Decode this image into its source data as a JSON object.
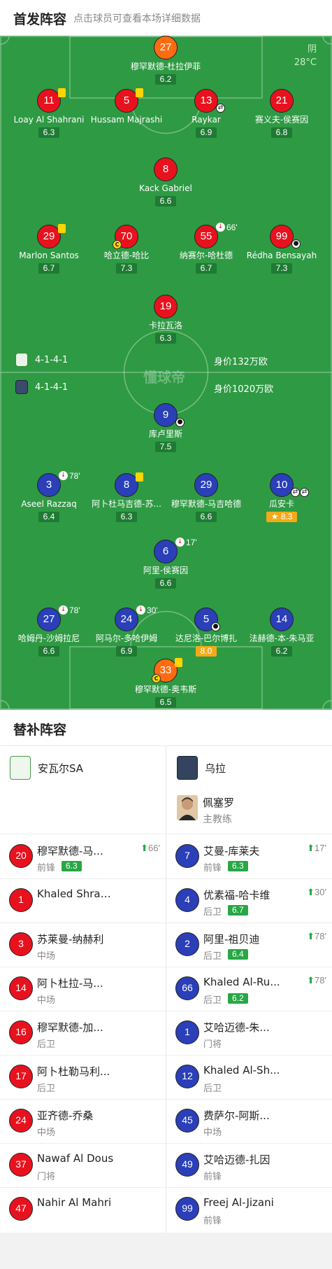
{
  "header": {
    "title": "首发阵容",
    "subtitle": "点击球员可查看本场详细数据"
  },
  "weather": {
    "condition": "阴",
    "temp": "28°C"
  },
  "watermark": "懂球帝",
  "home": {
    "team": "安瓦尔SA",
    "formation": "4-1-4-1",
    "value": "身价132万欧",
    "players": [
      {
        "num": "27",
        "name": "穆罕默德-杜拉伊菲",
        "rating": "6.2",
        "color": "orange"
      },
      {
        "num": "11",
        "name": "Loay Al Shahrani",
        "rating": "6.3",
        "color": "red"
      },
      {
        "num": "5",
        "name": "Hussam Majrashi",
        "rating": "",
        "color": "red"
      },
      {
        "num": "13",
        "name": "Raykar",
        "rating": "6.9",
        "color": "red"
      },
      {
        "num": "21",
        "name": "赛义夫-侯赛因",
        "rating": "6.8",
        "color": "red"
      },
      {
        "num": "8",
        "name": "Kack Gabriel",
        "rating": "6.6",
        "color": "red"
      },
      {
        "num": "29",
        "name": "Marlon Santos",
        "rating": "6.7",
        "color": "red"
      },
      {
        "num": "70",
        "name": "哈立德-哈比",
        "rating": "7.3",
        "color": "red"
      },
      {
        "num": "55",
        "name": "纳赛尔-哈杜德",
        "rating": "6.7",
        "color": "red",
        "sub": "66'"
      },
      {
        "num": "99",
        "name": "Rédha Bensayah",
        "rating": "7.3",
        "color": "red"
      },
      {
        "num": "19",
        "name": "卡拉瓦洛",
        "rating": "6.3",
        "color": "red"
      }
    ]
  },
  "away": {
    "team": "乌拉",
    "formation": "4-1-4-1",
    "value": "身价1020万欧",
    "coach": {
      "name": "佩塞罗",
      "role": "主教练"
    },
    "players": [
      {
        "num": "9",
        "name": "库卢里斯",
        "rating": "7.5",
        "color": "blue"
      },
      {
        "num": "3",
        "name": "Aseel Razzaq",
        "rating": "6.4",
        "color": "blue",
        "sub": "78'"
      },
      {
        "num": "8",
        "name": "阿卜杜马吉德-苏...",
        "rating": "6.3",
        "color": "blue"
      },
      {
        "num": "29",
        "name": "穆罕默德-马吉哈德",
        "rating": "6.6",
        "color": "blue"
      },
      {
        "num": "10",
        "name": "瓜安卡",
        "rating": "8.3",
        "color": "blue"
      },
      {
        "num": "6",
        "name": "阿里-侯赛因",
        "rating": "6.6",
        "color": "blue",
        "sub": "17'"
      },
      {
        "num": "27",
        "name": "哈姆丹-沙姆拉尼",
        "rating": "6.6",
        "color": "blue",
        "sub": "78'"
      },
      {
        "num": "24",
        "name": "阿马尔-多哈伊姆",
        "rating": "6.9",
        "color": "blue",
        "sub": "30'"
      },
      {
        "num": "5",
        "name": "达尼洛-巴尔博扎",
        "rating": "8.0",
        "color": "blue"
      },
      {
        "num": "14",
        "name": "法赫德-本-朱马亚",
        "rating": "6.2",
        "color": "blue"
      },
      {
        "num": "33",
        "name": "穆罕默德-奥韦斯",
        "rating": "6.5",
        "color": "orange"
      }
    ]
  },
  "subs_title": "替补阵容",
  "home_subs": [
    {
      "num": "20",
      "name": "穆罕默德-马...",
      "pos": "前锋",
      "rating": "6.3",
      "minute": "66'"
    },
    {
      "num": "1",
      "name": "Khaled Shrahili",
      "pos": "",
      "rating": "",
      "minute": ""
    },
    {
      "num": "3",
      "name": "苏莱曼-纳赫利",
      "pos": "中场",
      "rating": "",
      "minute": ""
    },
    {
      "num": "14",
      "name": "阿卜杜拉-马...",
      "pos": "中场",
      "rating": "",
      "minute": ""
    },
    {
      "num": "16",
      "name": "穆罕默德-加...",
      "pos": "后卫",
      "rating": "",
      "minute": ""
    },
    {
      "num": "17",
      "name": "阿卜杜勒马利...",
      "pos": "后卫",
      "rating": "",
      "minute": ""
    },
    {
      "num": "24",
      "name": "亚齐德-乔桑",
      "pos": "中场",
      "rating": "",
      "minute": ""
    },
    {
      "num": "37",
      "name": "Nawaf Al Dous",
      "pos": "门将",
      "rating": "",
      "minute": ""
    },
    {
      "num": "47",
      "name": "Nahir Al Mahri",
      "pos": "",
      "rating": "",
      "minute": ""
    }
  ],
  "away_subs": [
    {
      "num": "7",
      "name": "艾曼-库莱夫",
      "pos": "前锋",
      "rating": "6.3",
      "minute": "17'"
    },
    {
      "num": "4",
      "name": "优素福-哈卡维",
      "pos": "后卫",
      "rating": "6.7",
      "minute": "30'"
    },
    {
      "num": "2",
      "name": "阿里-祖贝迪",
      "pos": "后卫",
      "rating": "6.4",
      "minute": "78'"
    },
    {
      "num": "66",
      "name": "Khaled Al-Ru...",
      "pos": "后卫",
      "rating": "6.2",
      "minute": "78'"
    },
    {
      "num": "1",
      "name": "艾哈迈德-朱...",
      "pos": "门将",
      "rating": "",
      "minute": ""
    },
    {
      "num": "12",
      "name": "Khaled Al-Sh...",
      "pos": "后卫",
      "rating": "",
      "minute": ""
    },
    {
      "num": "45",
      "name": "费萨尔-阿斯...",
      "pos": "中场",
      "rating": "",
      "minute": ""
    },
    {
      "num": "49",
      "name": "艾哈迈德-扎因",
      "pos": "前锋",
      "rating": "",
      "minute": ""
    },
    {
      "num": "99",
      "name": "Freej Al-Jizani",
      "pos": "前锋",
      "rating": "",
      "minute": ""
    }
  ],
  "colors": {
    "home": "#e8121e",
    "away": "#2a3fb8",
    "gk": "#ff6b10",
    "pitch": "#2f9a44",
    "rating_gold": "#f3aa18"
  }
}
